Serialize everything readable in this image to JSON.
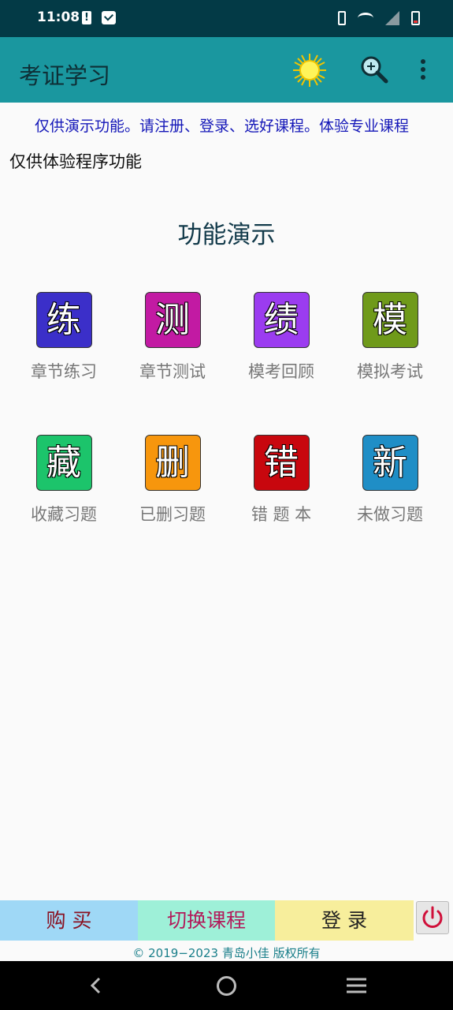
{
  "status": {
    "time": "11:08"
  },
  "app": {
    "title": "考证学习"
  },
  "marquee": "仅供演示功能。请注册、登录、选好课程。体验专业课程",
  "notice": "仅供体验程序功能",
  "section_title": "功能演示",
  "tiles": [
    {
      "glyph": "练",
      "label": "章节练习",
      "color": "#3b2fc9"
    },
    {
      "glyph": "测",
      "label": "章节测试",
      "color": "#c21aa3"
    },
    {
      "glyph": "绩",
      "label": "模考回顾",
      "color": "#9b3cf0"
    },
    {
      "glyph": "模",
      "label": "模拟考试",
      "color": "#6f9a1a"
    },
    {
      "glyph": "藏",
      "label": "收藏习题",
      "color": "#1cc46b"
    },
    {
      "glyph": "删",
      "label": "已删习题",
      "color": "#f7960d"
    },
    {
      "glyph": "错",
      "label": "错 题 本",
      "color": "#c8070e"
    },
    {
      "glyph": "新",
      "label": "未做习题",
      "color": "#1f8ec6"
    }
  ],
  "bottom": {
    "buy": "购 买",
    "switch_course": "切换课程",
    "login": "登 录"
  },
  "copyright": "© 2019−2023 青岛小佳 版权所有",
  "icons": {
    "sun": "sun-icon",
    "search": "search-icon",
    "more": "more-icon",
    "power": "power-icon"
  }
}
